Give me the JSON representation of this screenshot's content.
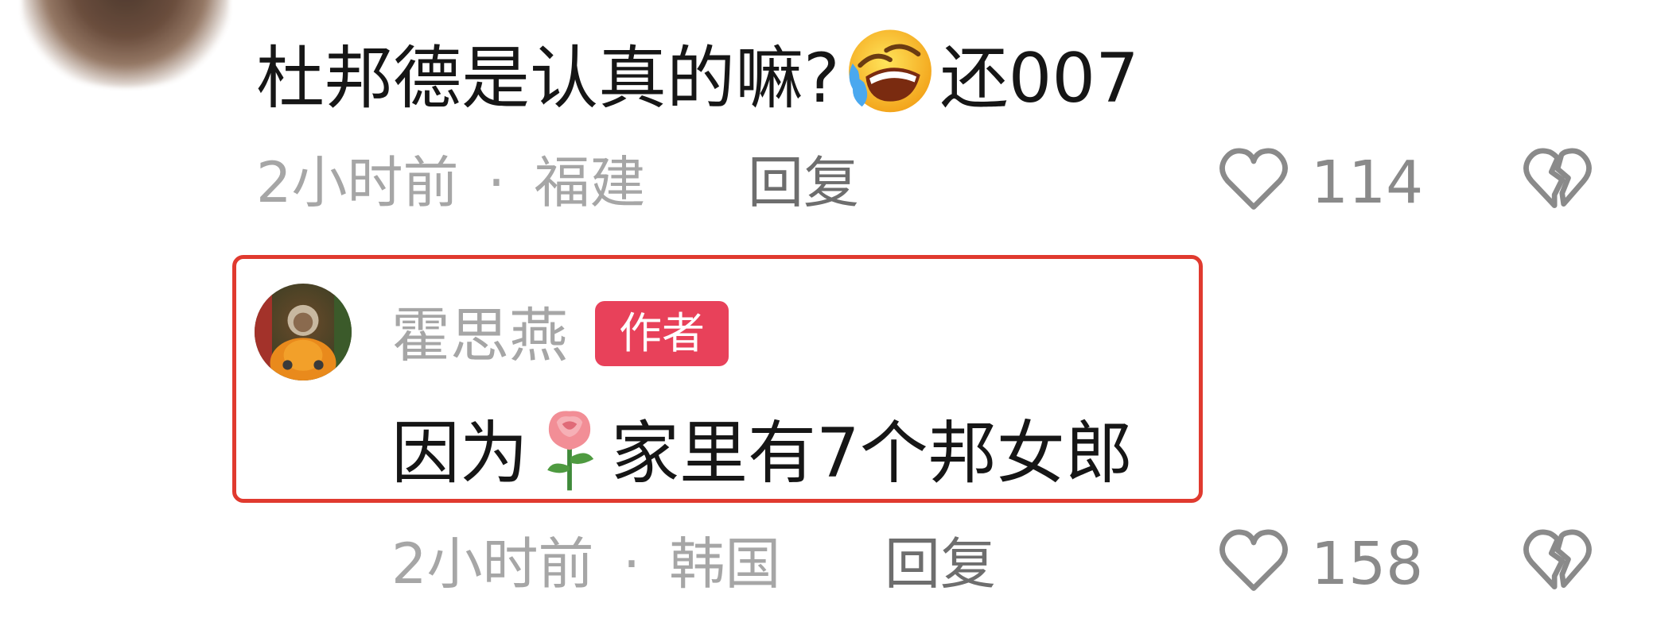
{
  "comment": {
    "text_before": "杜邦德是认真的嘛?",
    "emoji": "rolling-on-floor-laughing-emoji",
    "text_after": "还007",
    "time": "2小时前",
    "separator": "·",
    "location": "福建",
    "reply_label": "回复",
    "like_count": "114"
  },
  "reply": {
    "author_name": "霍思燕",
    "author_badge": "作者",
    "text_before": "因为",
    "emoji": "rose-emoji",
    "text_after": "家里有7个邦女郎",
    "time": "2小时前",
    "separator": "·",
    "location": "韩国",
    "reply_label": "回复",
    "like_count": "158"
  },
  "colors": {
    "highlight_border": "#e03a2f",
    "badge_bg": "#e8415a",
    "meta_text": "#a6a6a6",
    "main_text": "#161616"
  }
}
